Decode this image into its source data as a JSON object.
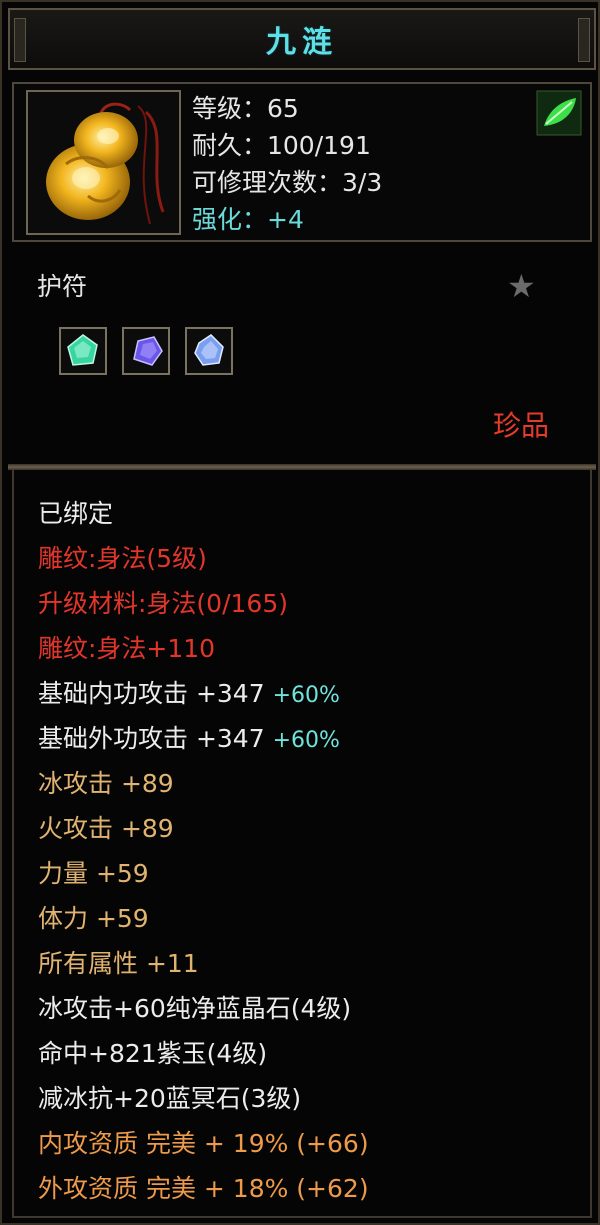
{
  "item": {
    "name": "九涟",
    "type": "护符",
    "rarity": "珍品"
  },
  "stats": {
    "level": "等级：65",
    "durability": "耐久：100/191",
    "repairs": "可修理次数：3/3",
    "enhance": "强化：+4"
  },
  "gems": [
    {
      "name": "green-gem-icon",
      "color": "#37d6a0"
    },
    {
      "name": "purple-gem-icon",
      "color": "#6a56e8"
    },
    {
      "name": "blue-gem-icon",
      "color": "#7a9ff0"
    }
  ],
  "attributes": {
    "bound": "已绑定",
    "carving": "雕纹:身法(5级)",
    "upgrade_material": "升级材料:身法(0/165)",
    "carving_bonus": "雕纹:身法+110",
    "inner_attack": {
      "text": "基础内功攻击 +347",
      "pct": "+60%"
    },
    "outer_attack": {
      "text": "基础外功攻击 +347",
      "pct": "+60%"
    },
    "ice_attack": "冰攻击 +89",
    "fire_attack": "火攻击 +89",
    "strength": "力量 +59",
    "stamina": "体力 +59",
    "all_attributes": "所有属性 +11",
    "socket_1": "冰攻击+60纯净蓝晶石(4级)",
    "socket_2": "命中+821紫玉(4级)",
    "socket_3": "减冰抗+20蓝冥石(3级)",
    "inner_quality": "内攻资质 完美 + 19% (+66)",
    "outer_quality": "外攻资质 完美 + 18% (+62)"
  },
  "colors": {
    "title": "#5fe0e6",
    "red": "#e2362b",
    "gold": "#e0b370",
    "cyan": "#6fe3dc",
    "orange": "#ed9a4a"
  }
}
